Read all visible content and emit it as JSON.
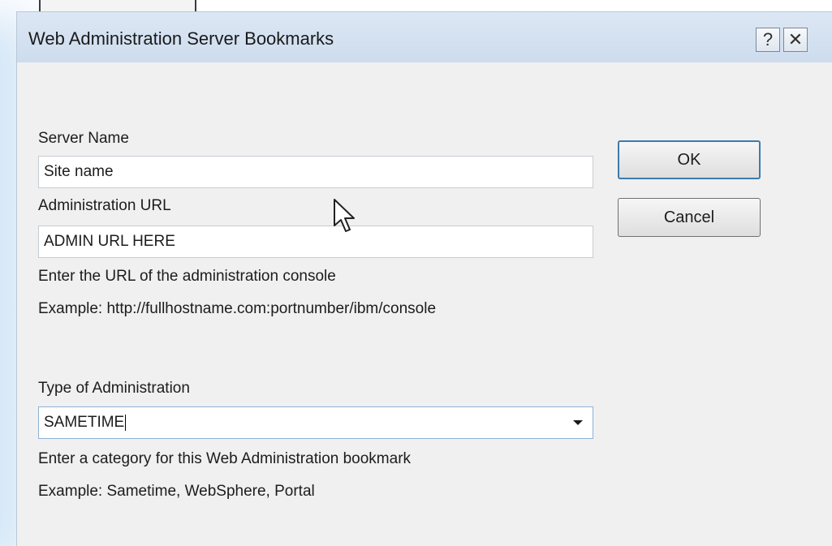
{
  "dialog": {
    "title": "Web Administration Server Bookmarks",
    "help_glyph": "?",
    "close_glyph": "✕"
  },
  "form": {
    "server_name_label": "Server Name",
    "server_name_value": "Site name",
    "admin_url_label": "Administration URL",
    "admin_url_value": "ADMIN URL HERE",
    "admin_url_help": "Enter the URL of the administration console",
    "admin_url_example": "Example: http://fullhostname.com:portnumber/ibm/console",
    "type_label": "Type of Administration",
    "type_value": "SAMETIME",
    "type_help": "Enter a category for this Web Administration bookmark",
    "type_example": "Example: Sametime, WebSphere, Portal"
  },
  "buttons": {
    "ok": "OK",
    "cancel": "Cancel"
  },
  "colors": {
    "titlebar": "#cddcee",
    "dialog_bg": "#f0f0f0",
    "default_button_border": "#3d7bad"
  },
  "icons": {
    "pointer": "mouse-pointer-icon",
    "dropdown": "chevron-down-icon"
  }
}
